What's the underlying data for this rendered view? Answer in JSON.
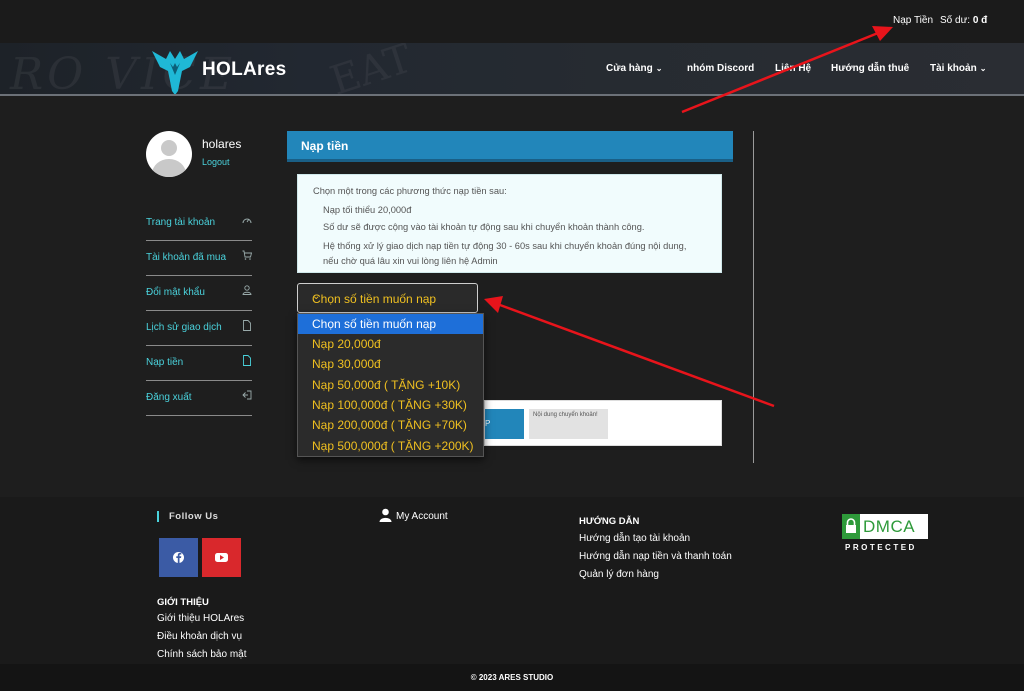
{
  "topbar": {
    "deposit_link": "Nạp Tiền",
    "balance_label": "Số dư:",
    "balance_value": "0 đ"
  },
  "header": {
    "brand": "HOLAres",
    "nav": [
      {
        "label": "Cửa hàng",
        "has_dropdown": true
      },
      {
        "label": "nhóm Discord",
        "has_dropdown": false
      },
      {
        "label": "Liên Hệ",
        "has_dropdown": false
      },
      {
        "label": "Hướng dẫn thuê",
        "has_dropdown": false
      },
      {
        "label": "Tài khoản",
        "has_dropdown": true
      }
    ]
  },
  "sidebar": {
    "username": "holares",
    "logout": "Logout",
    "items": [
      {
        "label": "Trang tài khoản",
        "icon": "gauge-icon"
      },
      {
        "label": "Tài khoản đã mua",
        "icon": "cart-icon"
      },
      {
        "label": "Đổi mật khẩu",
        "icon": "user-icon"
      },
      {
        "label": "Lịch sử giao dịch",
        "icon": "file-icon"
      },
      {
        "label": "Nạp tiền",
        "icon": "file-icon"
      },
      {
        "label": "Đăng xuất",
        "icon": "logout-icon"
      }
    ]
  },
  "main": {
    "title": "Nạp tiền",
    "info": {
      "intro": "Chọn một trong các phương thức nạp tiền sau:",
      "lines": [
        "Nạp tối thiểu 20,000đ",
        "Số dư sẽ được cộng vào tài khoản tự động sau khi chuyển khoản thành công.",
        "Hệ thống xử lý giao dịch nạp tiền tự động 30 - 60s sau khi chuyển khoản đúng nội dung, nếu chờ quá lâu xin vui lòng liên hệ Admin"
      ]
    },
    "select": {
      "value": "Chọn số tiền muốn nạp",
      "options": [
        "Chọn số tiền muốn nạp",
        "Nạp 20,000đ",
        "Nạp 30,000đ",
        "Nạp 50,000đ ( TẶNG +10K)",
        "Nạp 100,000đ ( TẶNG +30K)",
        "Nạp 200,000đ ( TẶNG +70K)",
        "Nạp 500,000đ ( TẶNG +200K)"
      ]
    },
    "transfer_content_placeholder": "Nội dung chuyển khoản!",
    "partial_button_text": "P"
  },
  "footer": {
    "follow_us": "Follow Us",
    "my_account": "My Account",
    "guide_title": "HƯỚNG DẪN",
    "guide_links": [
      "Hướng dẫn tạo tài khoản",
      "Hướng dẫn nạp tiền và thanh toán",
      "Quản lý đơn hàng"
    ],
    "about_title": "GIỚI THIỆU",
    "about_links": [
      "Giới thiệu HOLAres",
      "Điều khoản dịch vụ",
      "Chính sách bảo mật"
    ],
    "dmca_word": "DMCA",
    "dmca_protected": "PROTECTED",
    "copyright": "© 2023 ARES STUDIO"
  },
  "colors": {
    "accent": "#4ad2dc",
    "panel_blue": "#2286ba",
    "option_text": "#f0c020",
    "annotation_arrow": "#e8141b"
  }
}
